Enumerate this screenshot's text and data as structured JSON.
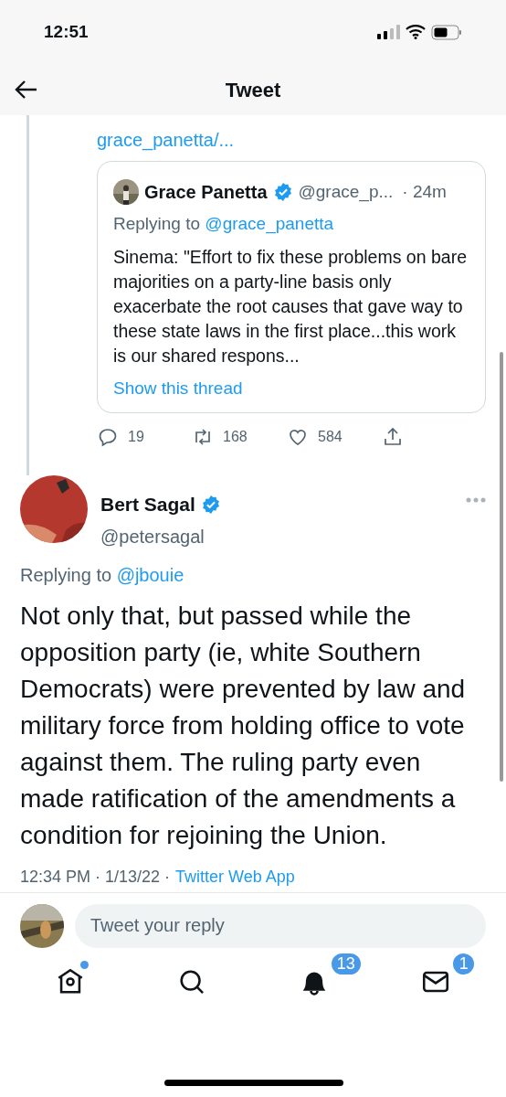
{
  "status_bar": {
    "time": "12:51"
  },
  "header": {
    "title": "Tweet"
  },
  "parent_tweet": {
    "link_fragment": "grace_panetta/...",
    "quoted": {
      "name": "Grace Panetta",
      "verified": true,
      "handle": "@grace_p...",
      "time": "· 24m",
      "replying_label": "Replying to",
      "replying_to": "@grace_panetta",
      "text": "Sinema: \"Effort to fix these problems on bare majorities on a party-line basis only exacerbate the root causes that gave way to these state laws in the first place...this work is our shared respons...",
      "show_thread": "Show this thread"
    },
    "actions": [
      {
        "kind": "reply",
        "count": "19"
      },
      {
        "kind": "retweet",
        "count": "168"
      },
      {
        "kind": "like",
        "count": "584"
      },
      {
        "kind": "share"
      }
    ]
  },
  "tweet": {
    "name": "Bert Sagal",
    "verified": true,
    "handle": "@petersagal",
    "replying_label": "Replying to",
    "replying_to": "@jbouie",
    "text": "Not only that, but passed while the opposition party (ie, white Southern Democrats) were prevented by law and military force from holding office to vote against them. The ruling party even made ratification of the amendments a condition for rejoining the Union.",
    "meta_time": "12:34 PM · 1/13/22 ·",
    "meta_source": "Twitter Web App"
  },
  "reply_bar": {
    "placeholder": "Tweet your reply"
  },
  "tab_bar": [
    {
      "kind": "home",
      "dot": true
    },
    {
      "kind": "search"
    },
    {
      "kind": "notifications",
      "badge": "13"
    },
    {
      "kind": "messages",
      "badge": "1"
    }
  ]
}
